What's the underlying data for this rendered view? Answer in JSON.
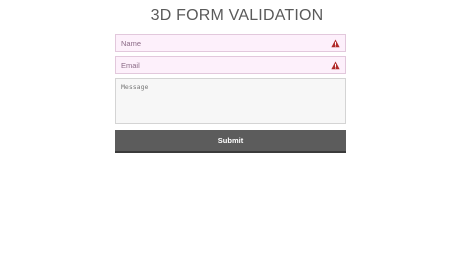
{
  "page": {
    "title": "3D FORM VALIDATION"
  },
  "form": {
    "name_placeholder": "Name",
    "email_placeholder": "Email",
    "message_placeholder": "Message",
    "submit_label": "Submit"
  },
  "icons": {
    "field_warning": "warning-icon"
  },
  "colors": {
    "title_text": "#5a5a5a",
    "invalid_field_bg": "#fdf0fb",
    "invalid_field_border": "#e2c8dc",
    "warning_icon": "#b12b2b",
    "message_bg": "#f7f7f7",
    "submit_bg": "#5c5c5c",
    "submit_text": "#ffffff"
  }
}
